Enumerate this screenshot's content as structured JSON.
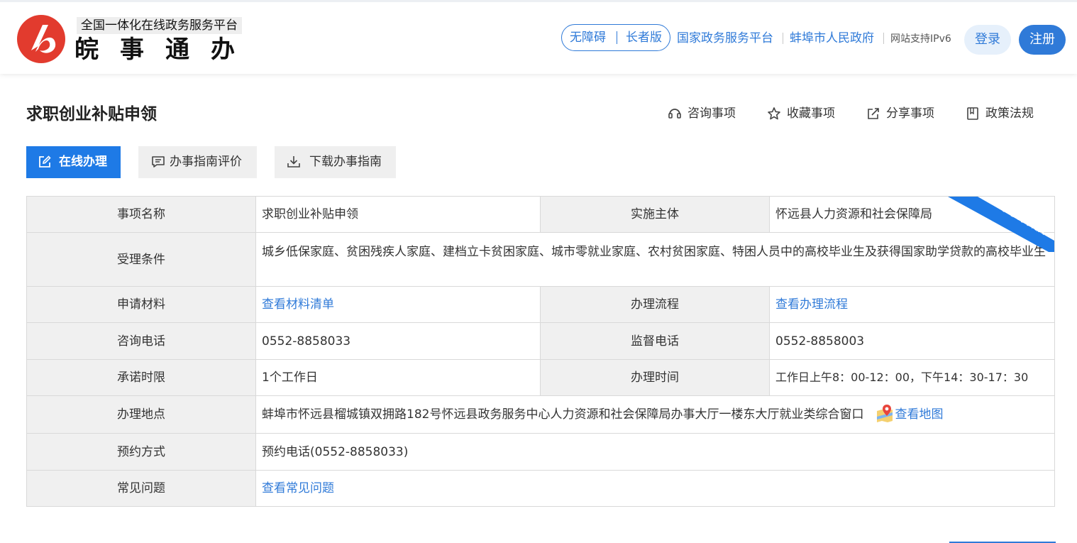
{
  "header": {
    "platform_subtitle": "全国一体化在线政务服务平台",
    "brand_name": "皖事通办",
    "accessibility_label": "无障碍",
    "elderly_label": "长者版",
    "national_platform_link": "国家政务服务平台",
    "city_gov_link": "蚌埠市人民政府",
    "ipv6_note": "网站支持IPv6",
    "login_label": "登录",
    "register_label": "注册"
  },
  "page": {
    "title": "求职创业补贴申领",
    "actions": {
      "consult": "咨询事项",
      "favorite": "收藏事项",
      "share": "分享事项",
      "policy": "政策法规"
    },
    "tabs": {
      "online": "在线办理",
      "guide_eval": "办事指南评价",
      "download_guide": "下载办事指南"
    },
    "ribbon": "简洁版"
  },
  "table": {
    "item_name_label": "事项名称",
    "item_name": "求职创业补贴申领",
    "agency_label": "实施主体",
    "agency": "怀远县人力资源和社会保障局",
    "conditions_label": "受理条件",
    "conditions": "城乡低保家庭、贫困残疾人家庭、建档立卡贫困家庭、城市零就业家庭、农村贫困家庭、特困人员中的高校毕业生及获得国家助学贷款的高校毕业生",
    "materials_label": "申请材料",
    "materials_link": "查看材料清单",
    "process_label": "办理流程",
    "process_link": "查看办理流程",
    "consult_phone_label": "咨询电话",
    "consult_phone": "0552-8858033",
    "supervise_phone_label": "监督电话",
    "supervise_phone": "0552-8858003",
    "time_limit_label": "承诺时限",
    "time_limit": "1个工作日",
    "office_hours_label": "办理时间",
    "office_hours": "工作日上午8：00-12：00，下午14：30-17：30",
    "address_label": "办理地点",
    "address": "蚌埠市怀远县榴城镇双拥路182号怀远县政务服务中心人力资源和社会保障局办事大厅一楼东大厅就业类综合窗口",
    "map_link": "查看地图",
    "appointment_label": "预约方式",
    "appointment": "预约电话(0552-8858033)",
    "faq_label": "常见问题",
    "faq_link": "查看常见问题"
  },
  "colors": {
    "accent": "#2f7ad8",
    "tab_active": "#1e7ae6",
    "logo_red": "#e23b2e",
    "label_bg": "#f0f0f0"
  }
}
